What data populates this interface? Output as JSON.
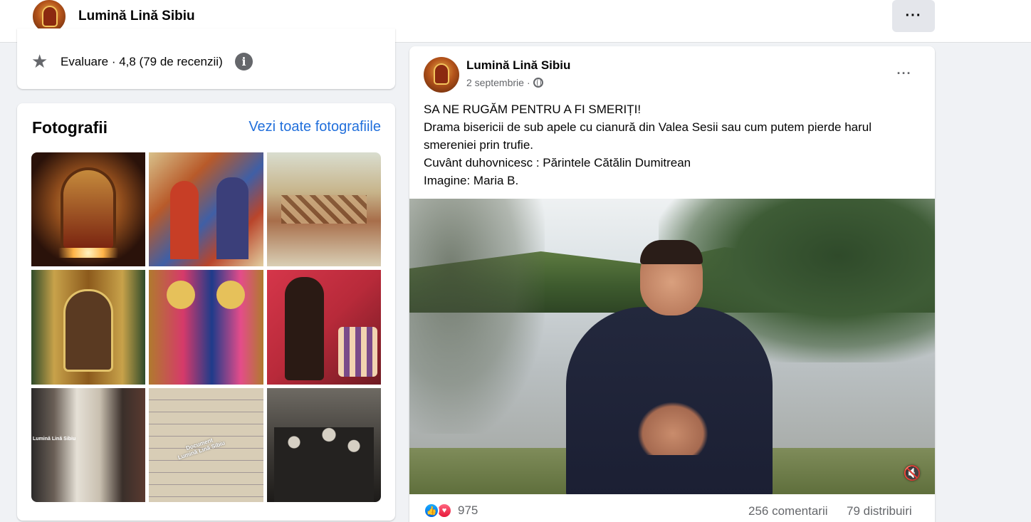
{
  "header": {
    "page_name": "Lumină Lină Sibiu",
    "more_label": "···"
  },
  "rating": {
    "text": "Evaluare · 4,8 (79 de recenzii)",
    "info_glyph": "i"
  },
  "photos": {
    "title": "Fotografii",
    "see_all": "Vezi toate fotografiile",
    "watermark_1": "Lumină Lină Sibiu",
    "watermark_2_line1": "Document",
    "watermark_2_line2": "Lumină Lină Sibiu"
  },
  "post": {
    "author": "Lumină Lină Sibiu",
    "date": "2 septembrie",
    "separator": "·",
    "more_label": "···",
    "text_lines": [
      "SA NE RUGĂM PENTRU A FI SMERIȚI!",
      "Drama bisericii de sub apele cu cianură din Valea Sesii sau cum putem pierde harul smereniei prin trufie.",
      "Cuvânt duhovnicesc : Părintele Cătălin Dumitrean",
      "Imagine: Maria B."
    ],
    "reaction_count": "975",
    "comments": "256 comentarii",
    "shares": "79 distribuiri"
  },
  "icons": {
    "star": "star-icon",
    "info": "info-icon",
    "globe": "globe-icon",
    "mute": "mute-icon",
    "like": "like-icon",
    "love": "love-icon"
  },
  "colors": {
    "link": "#216fdb",
    "like": "#0165e1",
    "love": "#e61739",
    "background": "#f0f2f5"
  }
}
